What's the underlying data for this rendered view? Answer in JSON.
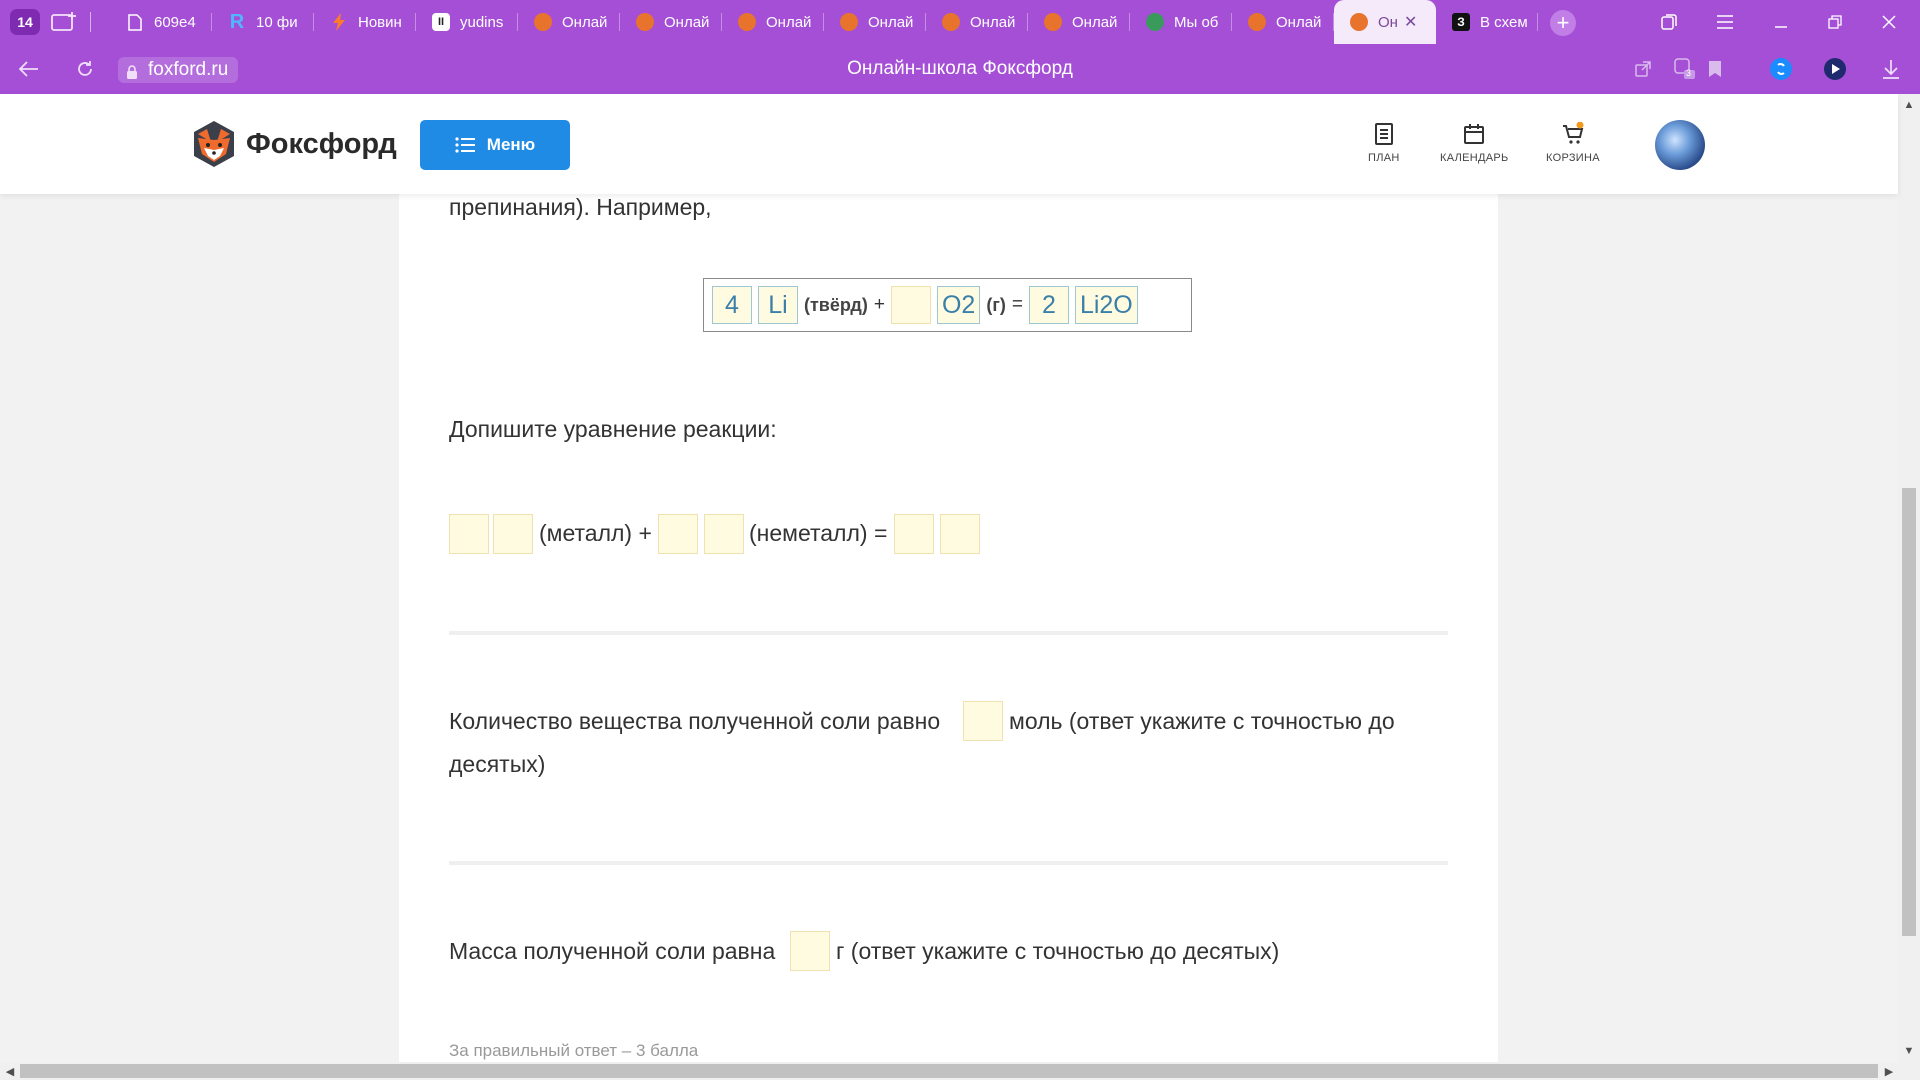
{
  "browser": {
    "tab_count": "14",
    "tabs": [
      {
        "label": "609e4",
        "icon": "document-icon"
      },
      {
        "label": "10 фи",
        "icon": "r-logo-icon"
      },
      {
        "label": "Новин",
        "icon": "lightning-icon"
      },
      {
        "label": "yudins",
        "icon": "pause-logo-icon"
      },
      {
        "label": "Онлай",
        "icon": "fox-icon"
      },
      {
        "label": "Онлай",
        "icon": "fox-icon"
      },
      {
        "label": "Онлай",
        "icon": "fox-icon"
      },
      {
        "label": "Онлай",
        "icon": "fox-icon"
      },
      {
        "label": "Онлай",
        "icon": "fox-icon"
      },
      {
        "label": "Онлай",
        "icon": "fox-icon"
      },
      {
        "label": "Мы об",
        "icon": "globe-icon"
      },
      {
        "label": "Онлай",
        "icon": "fox-icon"
      },
      {
        "label": "Он",
        "icon": "fox-icon",
        "active": true
      },
      {
        "label": "В схем",
        "icon": "z-logo-icon"
      }
    ],
    "url": "foxford.ru",
    "page_title": "Онлайн-школа Фоксфорд",
    "notification_badge": "3",
    "accent": "#a54fd6"
  },
  "header": {
    "logo_text": "Фоксфорд",
    "menu_label": "Меню",
    "nav": [
      {
        "label": "ПЛАН",
        "icon": "plan-icon"
      },
      {
        "label": "КАЛЕНДАРЬ",
        "icon": "calendar-icon"
      },
      {
        "label": "КОРЗИНА",
        "icon": "cart-icon"
      }
    ],
    "menu_color": "#1f8be5"
  },
  "content": {
    "intro_tail": "препинания). Например,",
    "example": {
      "coef1": "4",
      "formula1": "Li",
      "state1": "(твёрд)",
      "plus": "+",
      "coef2": "",
      "formula2": "O2",
      "state2": "(г)",
      "equals": "=",
      "coef3": "2",
      "formula3": "Li2O"
    },
    "task_prompt": "Допишите уравнение реакции:",
    "reaction": {
      "metal_label": "(металл) +",
      "nonmetal_label": "(неметалл) ="
    },
    "q1_before": "Количество вещества полученной соли равно",
    "q1_after": "моль (ответ укажите с точностью до",
    "q1_wrap": "десятых)",
    "q2_before": "Масса полученной соли равна",
    "q2_after": "г (ответ укажите с точностью до десятых)",
    "score_note": "За правильный ответ – 3 балла"
  }
}
